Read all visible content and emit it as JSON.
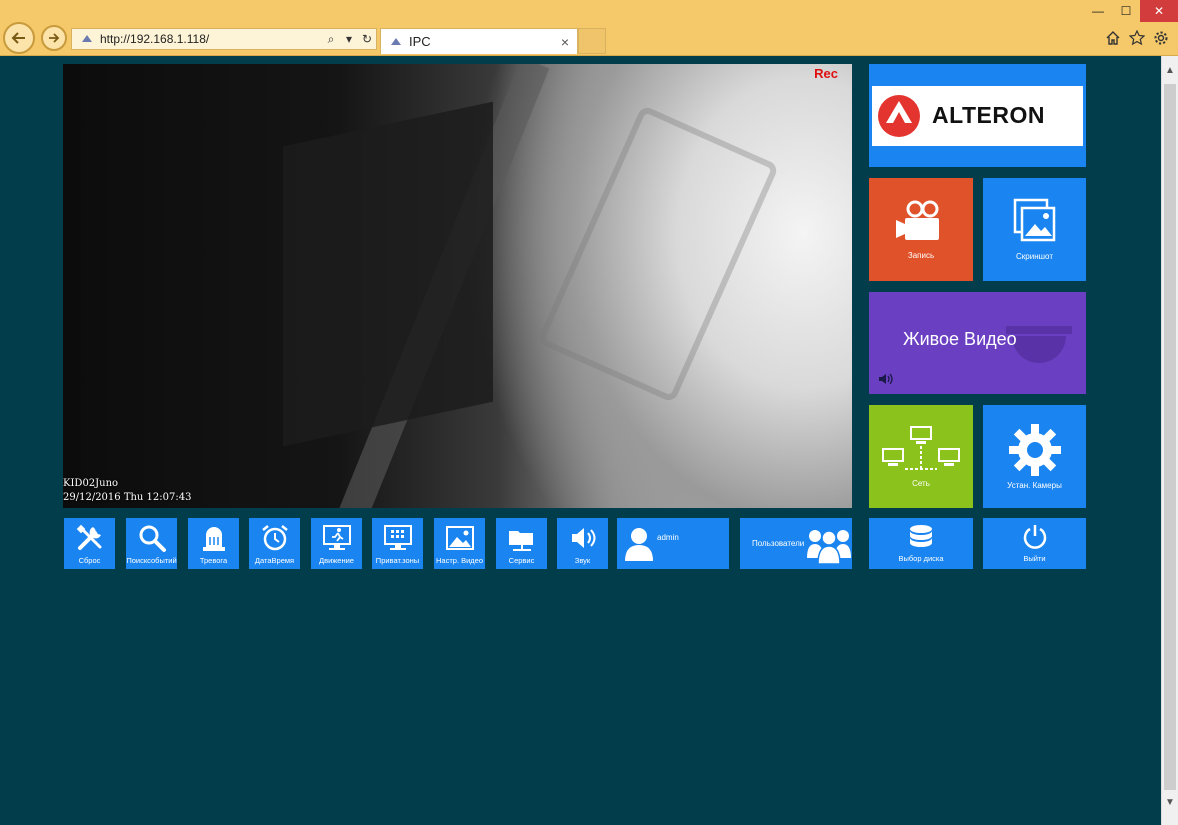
{
  "browser": {
    "url": "http://192.168.1.118/",
    "tab_title": "IPC",
    "tab_close": "×",
    "win_min": "—",
    "win_max": "☐",
    "win_close": "✕"
  },
  "video": {
    "rec": "Rec",
    "camera_name": "KID02Juno",
    "datetime": "29/12/2016 Thu 12:07:43"
  },
  "right_panel": {
    "logo_text": "ALTERON",
    "record_label": "Запись",
    "snapshot_label": "Скриншот",
    "live_video_label": "Живое Видео",
    "network_label": "Сеть",
    "camera_settings_label": "Устан. Камеры",
    "disk_select_label": "Выбор диска",
    "exit_label": "Выйти"
  },
  "toolbar": {
    "items": [
      {
        "label": "Сброс",
        "icon": "tools-icon"
      },
      {
        "label": "Поисксобытий",
        "icon": "search-icon"
      },
      {
        "label": "Тревога",
        "icon": "alarm-siren-icon"
      },
      {
        "label": "ДатаВремя",
        "icon": "alarm-clock-icon"
      },
      {
        "label": "Движение",
        "icon": "motion-icon"
      },
      {
        "label": "Приват.зоны",
        "icon": "privacy-zone-icon"
      },
      {
        "label": "Настр. Видео",
        "icon": "image-icon"
      },
      {
        "label": "Сервис",
        "icon": "folder-icon"
      },
      {
        "label": "Звук",
        "icon": "speaker-icon"
      }
    ],
    "user_label": "admin",
    "users_label": "Пользователи"
  },
  "colors": {
    "page_bg": "#023d4c",
    "tile_blue": "#1a85f0",
    "record_orange": "#e0522a",
    "live_purple": "#6b3fc2",
    "network_green": "#8cc21c",
    "rec_red": "#e01010"
  }
}
